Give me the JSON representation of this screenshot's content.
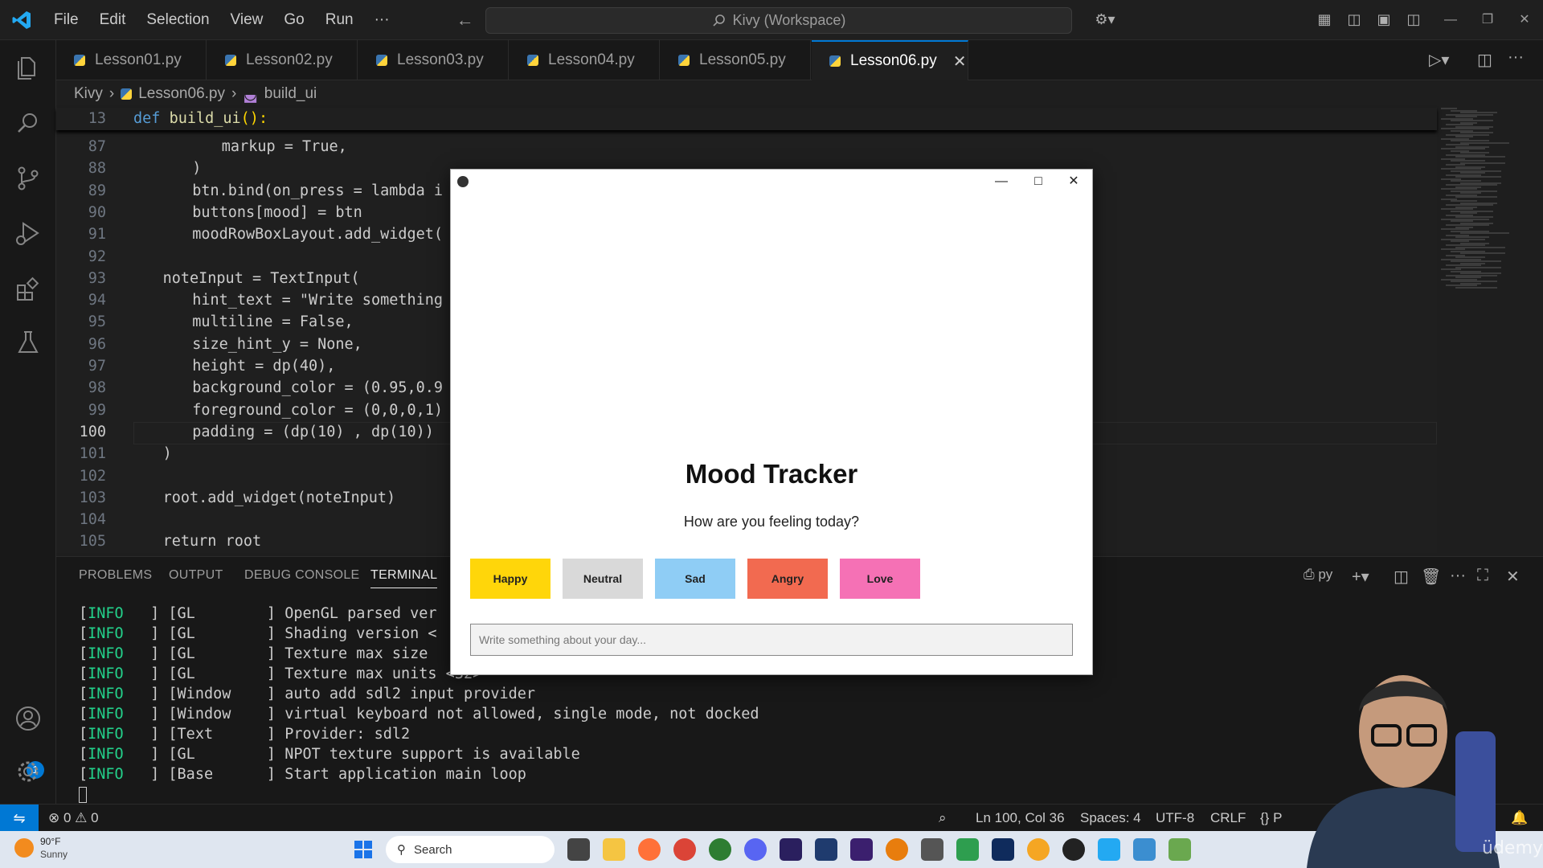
{
  "titlebar": {
    "menu": [
      "File",
      "Edit",
      "Selection",
      "View",
      "Go",
      "Run",
      "···"
    ],
    "command_center": "Kivy (Workspace)"
  },
  "tabs": [
    {
      "label": "Lesson01.py"
    },
    {
      "label": "Lesson02.py"
    },
    {
      "label": "Lesson03.py"
    },
    {
      "label": "Lesson04.py"
    },
    {
      "label": "Lesson05.py"
    },
    {
      "label": "Lesson06.py",
      "active": true
    }
  ],
  "breadcrumb": {
    "folder": "Kivy",
    "file": "Lesson06.py",
    "symbol": "build_ui"
  },
  "editor": {
    "sticky": {
      "num": "13",
      "text": "def build_ui():"
    },
    "lines": [
      {
        "num": "87",
        "text": "markup = True,"
      },
      {
        "num": "88",
        "text": ")"
      },
      {
        "num": "89",
        "text": "btn.bind(on_press = lambda i"
      },
      {
        "num": "90",
        "text": "buttons[mood] = btn"
      },
      {
        "num": "91",
        "text": "moodRowBoxLayout.add_widget("
      },
      {
        "num": "92",
        "text": ""
      },
      {
        "num": "93",
        "text": "noteInput = TextInput("
      },
      {
        "num": "94",
        "text": "hint_text = \"Write something"
      },
      {
        "num": "95",
        "text": "multiline = False,"
      },
      {
        "num": "96",
        "text": "size_hint_y = None,"
      },
      {
        "num": "97",
        "text": "height = dp(40),"
      },
      {
        "num": "98",
        "text": "background_color = (0.95,0.9"
      },
      {
        "num": "99",
        "text": "foreground_color = (0,0,0,1)"
      },
      {
        "num": "100",
        "text": "padding = (dp(10) , dp(10))"
      },
      {
        "num": "101",
        "text": ")"
      },
      {
        "num": "102",
        "text": ""
      },
      {
        "num": "103",
        "text": "root.add_widget(noteInput)"
      },
      {
        "num": "104",
        "text": ""
      },
      {
        "num": "105",
        "text": "return root"
      }
    ]
  },
  "panel": {
    "tabs": [
      "PROBLEMS",
      "OUTPUT",
      "DEBUG CONSOLE",
      "TERMINAL"
    ],
    "shell": "py",
    "terminal": [
      {
        "level": "INFO",
        "mod": "[GL        ]",
        "msg": "OpenGL parsed ver"
      },
      {
        "level": "INFO",
        "mod": "[GL        ]",
        "msg": "Shading version <"
      },
      {
        "level": "INFO",
        "mod": "[GL        ]",
        "msg": "Texture max size"
      },
      {
        "level": "INFO",
        "mod": "[GL        ]",
        "msg": "Texture max units <32>"
      },
      {
        "level": "INFO",
        "mod": "[Window    ]",
        "msg": "auto add sdl2 input provider"
      },
      {
        "level": "INFO",
        "mod": "[Window    ]",
        "msg": "virtual keyboard not allowed, single mode, not docked"
      },
      {
        "level": "INFO",
        "mod": "[Text      ]",
        "msg": "Provider: sdl2"
      },
      {
        "level": "INFO",
        "mod": "[GL        ]",
        "msg": "NPOT texture support is available"
      },
      {
        "level": "INFO",
        "mod": "[Base      ]",
        "msg": "Start application main loop"
      }
    ]
  },
  "statusbar": {
    "errors": "0",
    "warnings": "0",
    "position": "Ln 100, Col 36",
    "spaces": "Spaces: 4",
    "encoding": "UTF-8",
    "eol": "CRLF",
    "lang": "P"
  },
  "kivy_app": {
    "title": "Mood Tracker",
    "subtitle": "How are you feeling today?",
    "moods": [
      {
        "label": "Happy",
        "color": "#ffd60a"
      },
      {
        "label": "Neutral",
        "color": "#d9d9d9"
      },
      {
        "label": "Sad",
        "color": "#8fcdf5"
      },
      {
        "label": "Angry",
        "color": "#f26a50"
      },
      {
        "label": "Love",
        "color": "#f571b5"
      }
    ],
    "note_placeholder": "Write something about your day..."
  },
  "taskbar": {
    "weather_temp": "90°F",
    "weather_text": "Sunny",
    "search": "Search"
  },
  "badge_count": "1",
  "watermark": "üdemy"
}
